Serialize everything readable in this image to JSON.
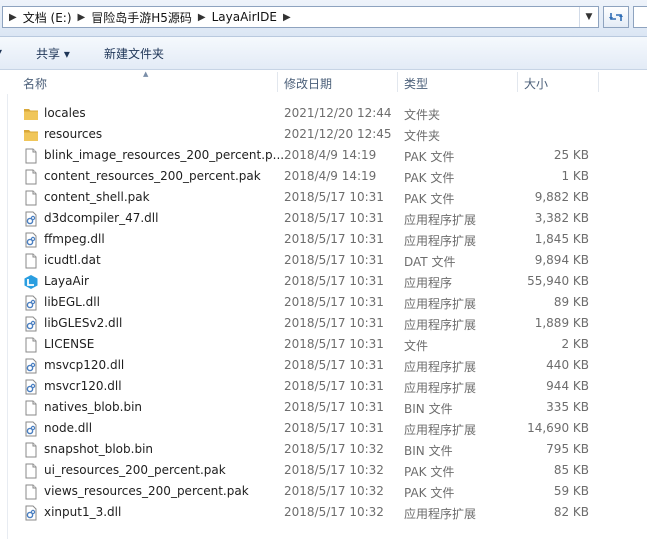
{
  "breadcrumb": [
    "文档 (E:)",
    "冒险岛手游H5源码",
    "LayaAirIDE"
  ],
  "toolbar": {
    "share_label": "共享 ▾",
    "new_folder_label": "新建文件夹"
  },
  "columns": {
    "name": "名称",
    "date": "修改日期",
    "type": "类型",
    "size": "大小"
  },
  "files": [
    {
      "name": "locales",
      "date": "2021/12/20 12:44",
      "type": "文件夹",
      "size": "",
      "icon": "folder-icon"
    },
    {
      "name": "resources",
      "date": "2021/12/20 12:45",
      "type": "文件夹",
      "size": "",
      "icon": "folder-icon"
    },
    {
      "name": "blink_image_resources_200_percent.p...",
      "date": "2018/4/9 14:19",
      "type": "PAK 文件",
      "size": "25 KB",
      "icon": "file-icon"
    },
    {
      "name": "content_resources_200_percent.pak",
      "date": "2018/4/9 14:19",
      "type": "PAK 文件",
      "size": "1 KB",
      "icon": "file-icon"
    },
    {
      "name": "content_shell.pak",
      "date": "2018/5/17 10:31",
      "type": "PAK 文件",
      "size": "9,882 KB",
      "icon": "file-icon"
    },
    {
      "name": "d3dcompiler_47.dll",
      "date": "2018/5/17 10:31",
      "type": "应用程序扩展",
      "size": "3,382 KB",
      "icon": "dll-icon"
    },
    {
      "name": "ffmpeg.dll",
      "date": "2018/5/17 10:31",
      "type": "应用程序扩展",
      "size": "1,845 KB",
      "icon": "dll-icon"
    },
    {
      "name": "icudtl.dat",
      "date": "2018/5/17 10:31",
      "type": "DAT 文件",
      "size": "9,894 KB",
      "icon": "file-icon"
    },
    {
      "name": "LayaAir",
      "date": "2018/5/17 10:31",
      "type": "应用程序",
      "size": "55,940 KB",
      "icon": "layaair-app-icon"
    },
    {
      "name": "libEGL.dll",
      "date": "2018/5/17 10:31",
      "type": "应用程序扩展",
      "size": "89 KB",
      "icon": "dll-icon"
    },
    {
      "name": "libGLESv2.dll",
      "date": "2018/5/17 10:31",
      "type": "应用程序扩展",
      "size": "1,889 KB",
      "icon": "dll-icon"
    },
    {
      "name": "LICENSE",
      "date": "2018/5/17 10:31",
      "type": "文件",
      "size": "2 KB",
      "icon": "file-icon"
    },
    {
      "name": "msvcp120.dll",
      "date": "2018/5/17 10:31",
      "type": "应用程序扩展",
      "size": "440 KB",
      "icon": "dll-icon"
    },
    {
      "name": "msvcr120.dll",
      "date": "2018/5/17 10:31",
      "type": "应用程序扩展",
      "size": "944 KB",
      "icon": "dll-icon"
    },
    {
      "name": "natives_blob.bin",
      "date": "2018/5/17 10:31",
      "type": "BIN 文件",
      "size": "335 KB",
      "icon": "file-icon"
    },
    {
      "name": "node.dll",
      "date": "2018/5/17 10:31",
      "type": "应用程序扩展",
      "size": "14,690 KB",
      "icon": "dll-icon"
    },
    {
      "name": "snapshot_blob.bin",
      "date": "2018/5/17 10:32",
      "type": "BIN 文件",
      "size": "795 KB",
      "icon": "file-icon"
    },
    {
      "name": "ui_resources_200_percent.pak",
      "date": "2018/5/17 10:32",
      "type": "PAK 文件",
      "size": "85 KB",
      "icon": "file-icon"
    },
    {
      "name": "views_resources_200_percent.pak",
      "date": "2018/5/17 10:32",
      "type": "PAK 文件",
      "size": "59 KB",
      "icon": "file-icon"
    },
    {
      "name": "xinput1_3.dll",
      "date": "2018/5/17 10:32",
      "type": "应用程序扩展",
      "size": "82 KB",
      "icon": "dll-icon"
    }
  ],
  "colors": {
    "folder": "#e8b84a",
    "accent": "#2f80d1",
    "toolbar_text": "#1e3557"
  }
}
